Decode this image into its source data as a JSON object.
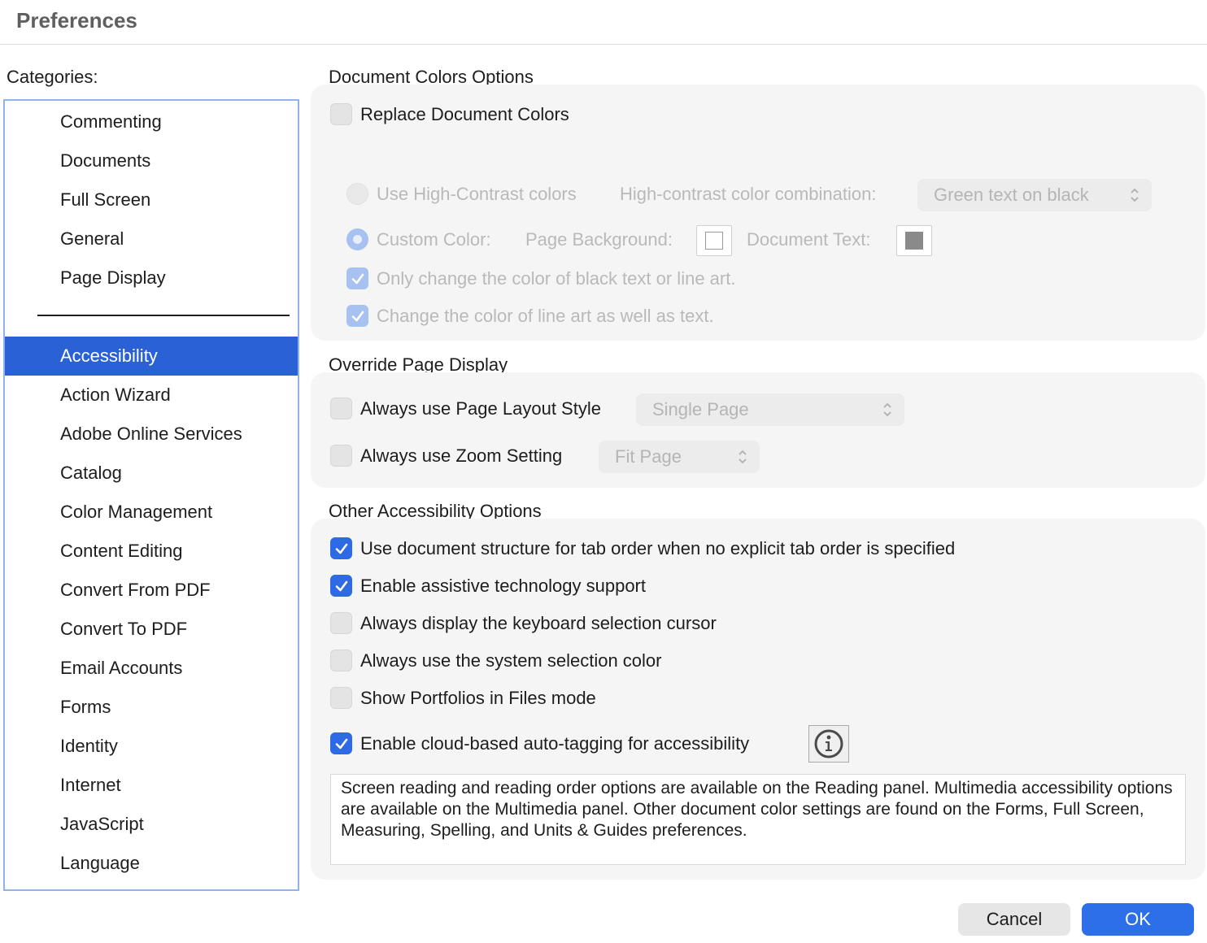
{
  "window": {
    "title": "Preferences"
  },
  "categories": {
    "label": "Categories:",
    "top_items": [
      "Commenting",
      "Documents",
      "Full Screen",
      "General",
      "Page Display"
    ],
    "items": [
      "Accessibility",
      "Action Wizard",
      "Adobe Online Services",
      "Catalog",
      "Color Management",
      "Content Editing",
      "Convert From PDF",
      "Convert To PDF",
      "Email Accounts",
      "Forms",
      "Identity",
      "Internet",
      "JavaScript",
      "Language"
    ],
    "selected": "Accessibility"
  },
  "document_colors": {
    "title": "Document Colors Options",
    "replace_label": "Replace Document Colors",
    "replace_checked": false,
    "high_contrast_label": "Use High-Contrast colors",
    "combination_label": "High-contrast color combination:",
    "combination_value": "Green text on black",
    "custom_color_label": "Custom Color:",
    "custom_color_selected": true,
    "page_background_label": "Page Background:",
    "page_background_color": "#ffffff",
    "document_text_label": "Document Text:",
    "document_text_color": "#8a8a8a",
    "only_black_label": "Only change the color of black text or line art.",
    "only_black_checked": true,
    "line_art_label": "Change the color of line art as well as text.",
    "line_art_checked": true
  },
  "override_page_display": {
    "title": "Override Page Display",
    "layout_label": "Always use Page Layout Style",
    "layout_checked": false,
    "layout_value": "Single Page",
    "zoom_label": "Always use Zoom Setting",
    "zoom_checked": false,
    "zoom_value": "Fit Page"
  },
  "other_options": {
    "title": "Other Accessibility Options",
    "options": [
      {
        "label": "Use document structure for tab order when no explicit tab order is specified",
        "checked": true
      },
      {
        "label": "Enable assistive technology support",
        "checked": true
      },
      {
        "label": "Always display the keyboard selection cursor",
        "checked": false
      },
      {
        "label": "Always use the system selection color",
        "checked": false
      },
      {
        "label": "Show Portfolios in Files mode",
        "checked": false
      },
      {
        "label": "Enable cloud-based auto-tagging for accessibility",
        "checked": true
      }
    ],
    "info_icon": "info-circle-icon",
    "note": "Screen reading and reading order options are available on the Reading panel. Multimedia accessibility options are available on the Multimedia panel. Other document color settings are found on the Forms, Full Screen, Measuring, Spelling, and Units & Guides preferences."
  },
  "buttons": {
    "cancel": "Cancel",
    "ok": "OK"
  },
  "colors": {
    "accent": "#2c6fe9",
    "selection": "#2a62d6"
  }
}
